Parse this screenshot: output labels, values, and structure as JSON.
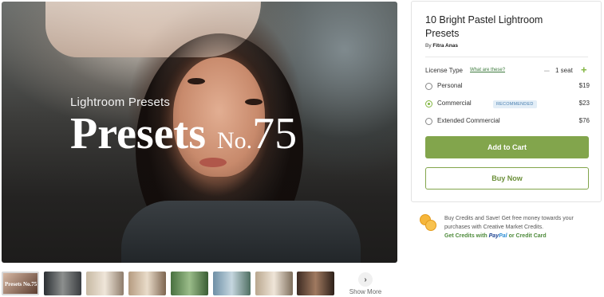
{
  "hero": {
    "subtitle": "Lightroom Presets",
    "title_main": "Presets",
    "title_no": "No.",
    "title_num": "75"
  },
  "thumbnails": {
    "first_label": "Presets No.75",
    "count": 8,
    "show_more_label": "Show More"
  },
  "product": {
    "title": "10 Bright Pastel Lightroom Presets",
    "author_prefix": "By",
    "author": "Fitra Anas"
  },
  "license": {
    "label": "License Type",
    "help_link": "What are these?",
    "quantity": "1 seat",
    "options": [
      {
        "name": "Personal",
        "price": "$19",
        "selected": false
      },
      {
        "name": "Commercial",
        "price": "$23",
        "selected": true,
        "badge": "RECOMMENDED"
      },
      {
        "name": "Extended Commercial",
        "price": "$76",
        "selected": false
      }
    ]
  },
  "actions": {
    "add_to_cart": "Add to Cart",
    "buy_now": "Buy Now"
  },
  "credits": {
    "text": "Buy Credits and Save! Get free money towards your purchases with Creative Market Credits.",
    "link_prefix": "Get Credits with",
    "paypal_a": "Pay",
    "paypal_b": "Pal",
    "link_suffix": "or Credit Card"
  },
  "colors": {
    "accent_green": "#82a54c",
    "badge_blue": "#e3eef7",
    "coin_gold": "#f6b63a"
  }
}
